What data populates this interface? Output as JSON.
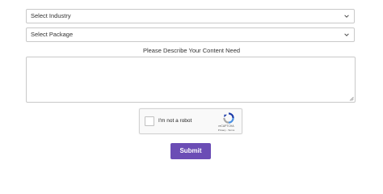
{
  "form": {
    "industry_select": {
      "value": "Select Industry",
      "icon": "chevron-down-icon"
    },
    "package_select": {
      "value": "Select Package",
      "icon": "chevron-down-icon"
    },
    "describe_label": "Please Describe Your Content Need",
    "content_textarea": {
      "value": "",
      "placeholder": ""
    },
    "captcha": {
      "checkbox_label": "I'm not a robot",
      "brand": "reCAPTCHA",
      "legal": "Privacy - Terms",
      "icon": "recaptcha-logo-icon"
    },
    "submit_label": "Submit"
  },
  "colors": {
    "submit_bg": "#6b4db5",
    "border": "#c9c9c9",
    "text": "#333333"
  }
}
